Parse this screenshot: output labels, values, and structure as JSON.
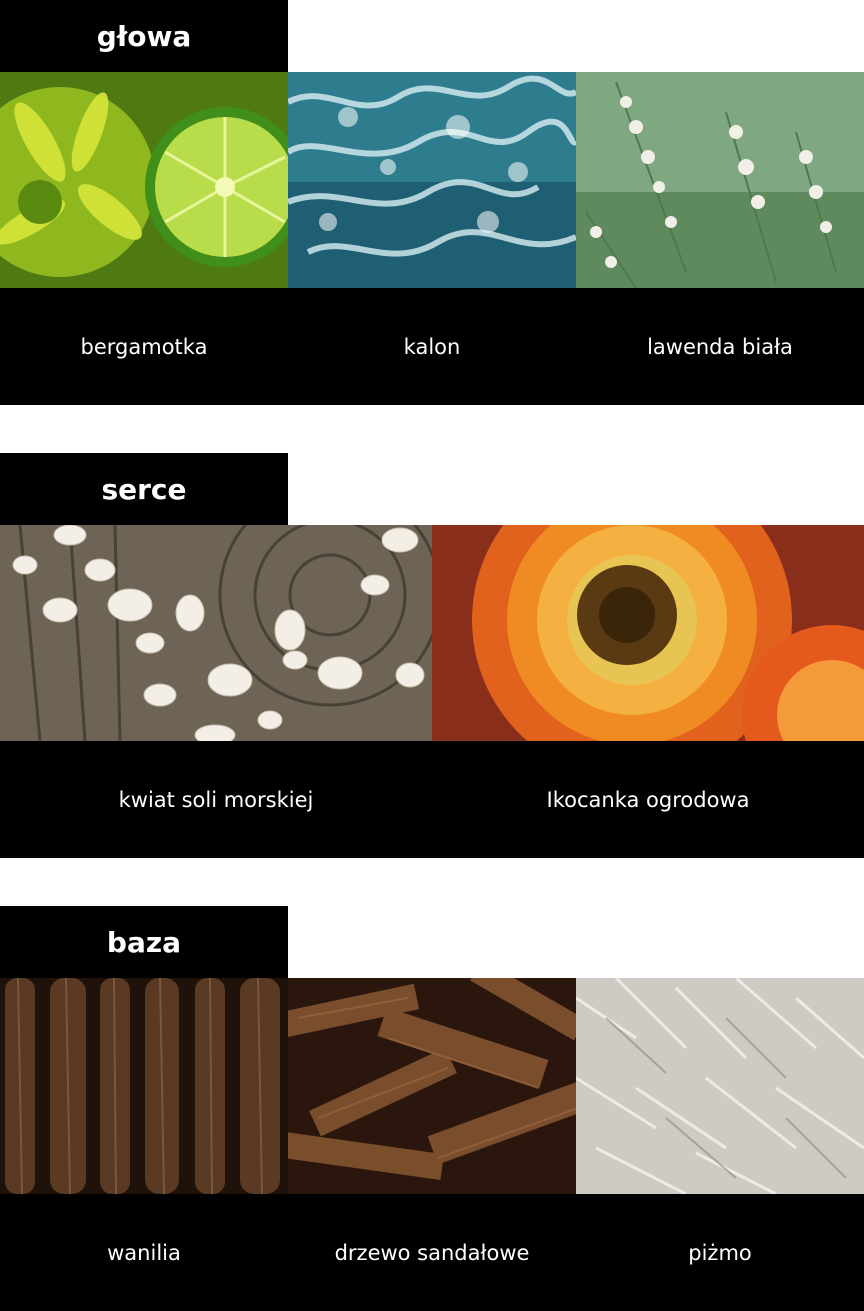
{
  "sections": [
    {
      "tag": "głowa",
      "notes": [
        {
          "label": "bergamotka",
          "image": "bergamot-image"
        },
        {
          "label": "kalon",
          "image": "sea-water-image"
        },
        {
          "label": "lawenda biała",
          "image": "white-lavender-image"
        }
      ]
    },
    {
      "tag": "serce",
      "notes": [
        {
          "label": "kwiat soli morskiej",
          "image": "sea-salt-on-wood-image"
        },
        {
          "label": "Ikocanka ogrodowa",
          "image": "strawflower-image"
        }
      ]
    },
    {
      "tag": "baza",
      "notes": [
        {
          "label": "wanilia",
          "image": "vanilla-pods-image"
        },
        {
          "label": "drzewo sandałowe",
          "image": "sandalwood-image"
        },
        {
          "label": "piżmo",
          "image": "fur-image"
        }
      ]
    }
  ]
}
